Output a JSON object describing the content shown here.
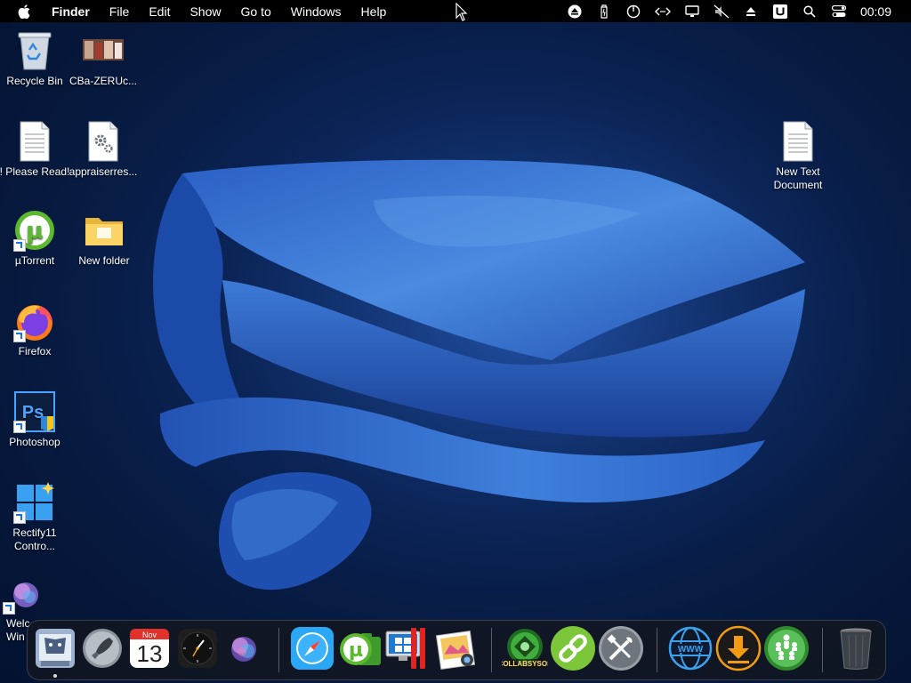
{
  "menubar": {
    "app_name": "Finder",
    "menus": [
      "File",
      "Edit",
      "Show",
      "Go to",
      "Windows",
      "Help"
    ],
    "status_icons": [
      "eject-icon",
      "battery-icon",
      "power-icon",
      "code-icon",
      "display-icon",
      "muted-icon",
      "upload-icon",
      "u-badge-icon",
      "search-icon",
      "control-center-icon"
    ],
    "clock": "00:09"
  },
  "desktop": {
    "icons": [
      {
        "name": "recycle-bin",
        "label": "Recycle Bin"
      },
      {
        "name": "image-file",
        "label": "CBa-ZERUc..."
      },
      {
        "name": "please-read",
        "label": "! Please Read!"
      },
      {
        "name": "appraiserres",
        "label": "appraiserres..."
      },
      {
        "name": "utorrent",
        "label": "µTorrent"
      },
      {
        "name": "new-folder",
        "label": "New folder"
      },
      {
        "name": "firefox",
        "label": "Firefox"
      },
      {
        "name": "photoshop",
        "label": "Photoshop"
      },
      {
        "name": "rectify11",
        "label": "Rectify11 Contro..."
      },
      {
        "name": "welcome",
        "label": "Welc Win"
      },
      {
        "name": "new-text-document",
        "label": "New Text Document"
      }
    ]
  },
  "dock": {
    "items": [
      {
        "name": "finder",
        "label": "Finder"
      },
      {
        "name": "launchpad",
        "label": "Launchpad"
      },
      {
        "name": "calendar",
        "label": "Calendar",
        "month": "Nov",
        "day": "13"
      },
      {
        "name": "clock-app",
        "label": "Clock"
      },
      {
        "name": "siri",
        "label": "Siri"
      },
      {
        "name": "safari",
        "label": "Safari"
      },
      {
        "name": "utorrent-dock",
        "label": "µTorrent"
      },
      {
        "name": "parallels",
        "label": "Parallels"
      },
      {
        "name": "photos",
        "label": "Photos"
      },
      {
        "name": "collabsysos",
        "label": "COLLABSYSOS"
      },
      {
        "name": "link-app",
        "label": "Link"
      },
      {
        "name": "tools-app",
        "label": "Tools"
      },
      {
        "name": "www-app",
        "label": "WWW"
      },
      {
        "name": "download-app",
        "label": "Download"
      },
      {
        "name": "network-app",
        "label": "Network"
      },
      {
        "name": "trash",
        "label": "Trash"
      }
    ]
  },
  "colors": {
    "menubar": "#000000",
    "wallpaper_dark": "#06183c",
    "ribbon": "#3a7bd5"
  }
}
